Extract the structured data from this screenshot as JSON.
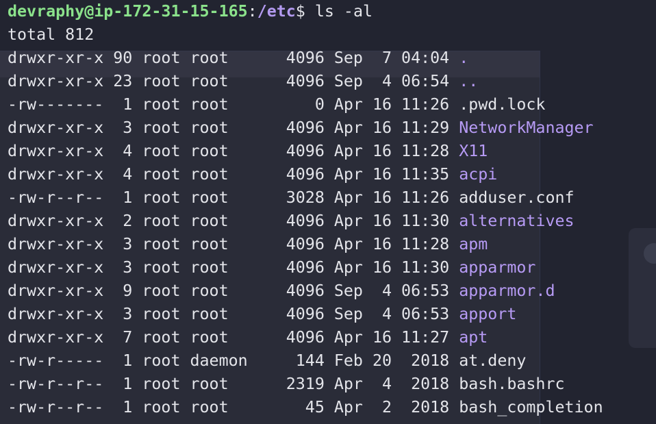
{
  "prompt": {
    "user_host": "devraphy@ip-172-31-15-165",
    "separator": ":",
    "path": "/etc",
    "symbol": "$",
    "command": " ls -al"
  },
  "total_line": "total 812",
  "entries": [
    {
      "meta": "drwxr-xr-x 90 root root      4096 Sep  7 04:04 ",
      "name": ".",
      "type": "dir"
    },
    {
      "meta": "drwxr-xr-x 23 root root      4096 Sep  4 06:54 ",
      "name": "..",
      "type": "dir"
    },
    {
      "meta": "-rw-------  1 root root         0 Apr 16 11:26 ",
      "name": ".pwd.lock",
      "type": "file"
    },
    {
      "meta": "drwxr-xr-x  3 root root      4096 Apr 16 11:29 ",
      "name": "NetworkManager",
      "type": "dir"
    },
    {
      "meta": "drwxr-xr-x  4 root root      4096 Apr 16 11:28 ",
      "name": "X11",
      "type": "dir"
    },
    {
      "meta": "drwxr-xr-x  4 root root      4096 Apr 16 11:35 ",
      "name": "acpi",
      "type": "dir"
    },
    {
      "meta": "-rw-r--r--  1 root root      3028 Apr 16 11:26 ",
      "name": "adduser.conf",
      "type": "file"
    },
    {
      "meta": "drwxr-xr-x  2 root root      4096 Apr 16 11:30 ",
      "name": "alternatives",
      "type": "dir"
    },
    {
      "meta": "drwxr-xr-x  3 root root      4096 Apr 16 11:28 ",
      "name": "apm",
      "type": "dir"
    },
    {
      "meta": "drwxr-xr-x  3 root root      4096 Apr 16 11:30 ",
      "name": "apparmor",
      "type": "dir"
    },
    {
      "meta": "drwxr-xr-x  9 root root      4096 Sep  4 06:53 ",
      "name": "apparmor.d",
      "type": "dir"
    },
    {
      "meta": "drwxr-xr-x  3 root root      4096 Sep  4 06:53 ",
      "name": "apport",
      "type": "dir"
    },
    {
      "meta": "drwxr-xr-x  7 root root      4096 Apr 16 11:27 ",
      "name": "apt",
      "type": "dir"
    },
    {
      "meta": "-rw-r-----  1 root daemon     144 Feb 20  2018 ",
      "name": "at.deny",
      "type": "file"
    },
    {
      "meta": "-rw-r--r--  1 root root      2319 Apr  4  2018 ",
      "name": "bash.bashrc",
      "type": "file"
    },
    {
      "meta": "-rw-r--r--  1 root root        45 Apr  2  2018 ",
      "name": "bash_completion",
      "type": "file"
    }
  ],
  "colors": {
    "background": "#222430",
    "prompt_user": "#8be28b",
    "directory": "#b79bf5",
    "text": "#e4e5ea"
  }
}
